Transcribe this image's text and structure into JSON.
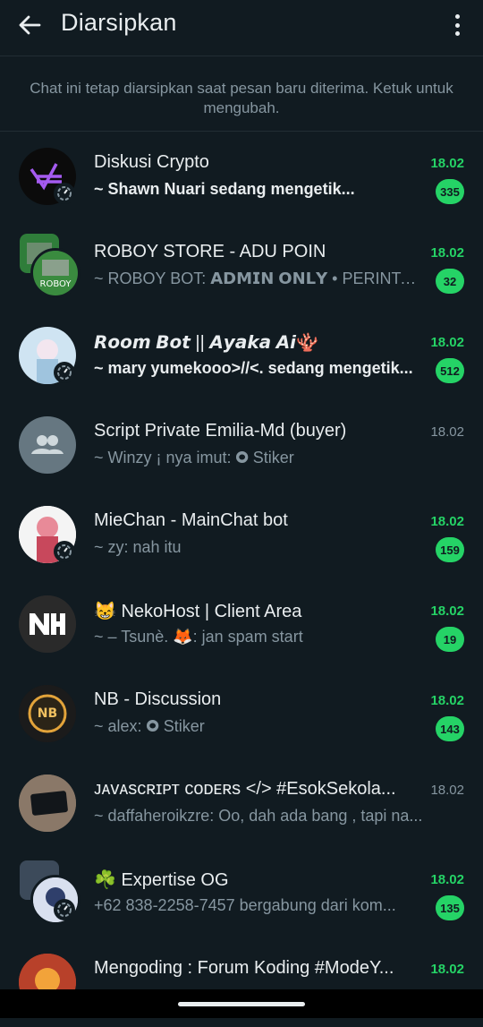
{
  "header": {
    "title": "Diarsipkan",
    "back_icon": "arrow-left-icon",
    "menu_icon": "more-vert-icon"
  },
  "notice": "Chat ini tetap diarsipkan saat pesan baru diterima. Ketuk untuk mengubah.",
  "colors": {
    "background": "#111b21",
    "accent": "#25d366",
    "secondary_text": "#8696a0"
  },
  "chats": [
    {
      "name": "Diskusi Crypto",
      "preview": "~ Shawn Nuari sedang mengetik...",
      "time": "18.02",
      "unread": "335",
      "typing": true
    },
    {
      "name": "ROBOY STORE - ADU POIN",
      "preview": "~ ROBOY BOT: 𝗔𝗗𝗠𝗜𝗡 𝗢𝗡𝗟𝗬 • PERINTAH INI...",
      "time": "18.02",
      "unread": "32",
      "typing": false
    },
    {
      "name": "𝙍𝙤𝙤𝙢 𝘽𝙤𝙩 || 𝘼𝙮𝙖𝙠𝙖 𝘼𝙞🪸",
      "preview": "~ mary yumekooo>//<. sedang mengetik...",
      "time": "18.02",
      "unread": "512",
      "typing": true
    },
    {
      "name": "Script Private Emilia-Md (buyer)",
      "preview": "~ Winzy ¡ nya imut: 🞉 Stiker",
      "time": "18.02",
      "unread": "",
      "typing": false
    },
    {
      "name": "MieChan - MainChat bot",
      "preview": "~ zy: nah itu",
      "time": "18.02",
      "unread": "159",
      "typing": false
    },
    {
      "name": "😸 NekoHost | Client Area",
      "preview": "~ – Tsunè. 🦊: jan spam start",
      "time": "18.02",
      "unread": "19",
      "typing": false
    },
    {
      "name": "NB - Discussion",
      "preview": "~ alex: 🞉 Stiker",
      "time": "18.02",
      "unread": "143",
      "typing": false
    },
    {
      "name": "ᴊᴀᴠᴀsᴄʀɪᴘᴛ ᴄᴏᴅᴇʀs </> #EsokSekola...",
      "preview": "~ daffaheroikzre: Oo, dah ada bang , tapi na...",
      "time": "18.02",
      "unread": "",
      "typing": false
    },
    {
      "name": "☘️ Expertise OG",
      "preview": "+62 838-2258-7457 bergabung dari kom...",
      "time": "18.02",
      "unread": "135",
      "typing": false
    },
    {
      "name": "Mengoding : Forum Koding #ModeY...",
      "preview": "",
      "time": "18.02",
      "unread": "",
      "typing": false
    }
  ]
}
